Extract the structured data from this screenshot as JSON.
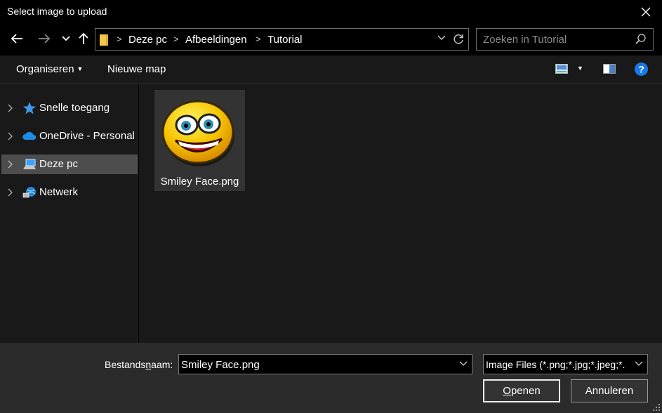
{
  "window": {
    "title": "Select image to upload"
  },
  "nav": {
    "breadcrumbs": [
      "Deze pc",
      "Afbeeldingen",
      "Tutorial"
    ],
    "search_placeholder": "Zoeken in Tutorial"
  },
  "toolbar": {
    "organize_label": "Organiseren",
    "new_folder_label": "Nieuwe map"
  },
  "sidebar": {
    "items": [
      {
        "label": "Snelle toegang",
        "icon": "star-icon"
      },
      {
        "label": "OneDrive - Personal",
        "icon": "cloud-icon"
      },
      {
        "label": "Deze pc",
        "icon": "computer-icon",
        "selected": true
      },
      {
        "label": "Netwerk",
        "icon": "network-icon"
      }
    ]
  },
  "files": [
    {
      "name": "Smiley Face.png",
      "icon": "smiley-thumbnail"
    }
  ],
  "footer": {
    "filename_label_pre": "Bestands",
    "filename_label_accel": "n",
    "filename_label_post": "aam:",
    "filename_value": "Smiley Face.png",
    "filter_value": "Image Files (*.png;*.jpg;*.jpeg;*.",
    "open_label_accel": "O",
    "open_label_rest": "penen",
    "cancel_label": "Annuleren"
  },
  "colors": {
    "accent": "#0078d7",
    "selection": "#4d4d4d",
    "background": "#191919"
  }
}
